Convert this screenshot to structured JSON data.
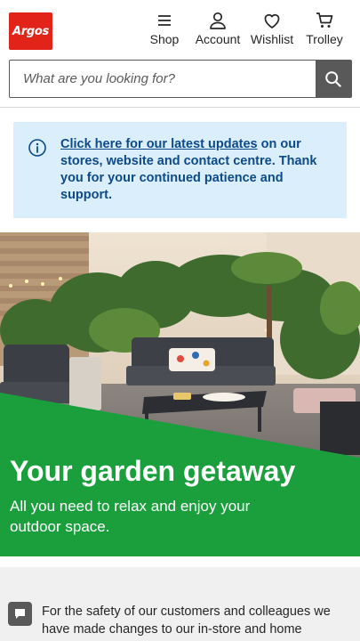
{
  "brand": {
    "logo_text": "Argos",
    "accent": "#e2231a"
  },
  "header": {
    "nav": [
      {
        "label": "Shop",
        "icon": "menu-icon"
      },
      {
        "label": "Account",
        "icon": "user-icon"
      },
      {
        "label": "Wishlist",
        "icon": "heart-icon"
      },
      {
        "label": "Trolley",
        "icon": "trolley-icon"
      }
    ]
  },
  "search": {
    "placeholder": "What are you looking for?",
    "value": ""
  },
  "notice": {
    "link_text": "Click here for our latest updates",
    "text": " on our stores, website and contact centre. Thank you for your continued patience and support.",
    "bg": "#dbeefb",
    "text_color": "#0c4a8a"
  },
  "hero": {
    "title": "Your garden getaway",
    "subtitle": "All you need to relax and enjoy your outdoor space.",
    "green": "#1b9f3d"
  },
  "safety": {
    "text": "For the safety of our customers and colleagues we have made changes to our in-store and home delivery services."
  }
}
